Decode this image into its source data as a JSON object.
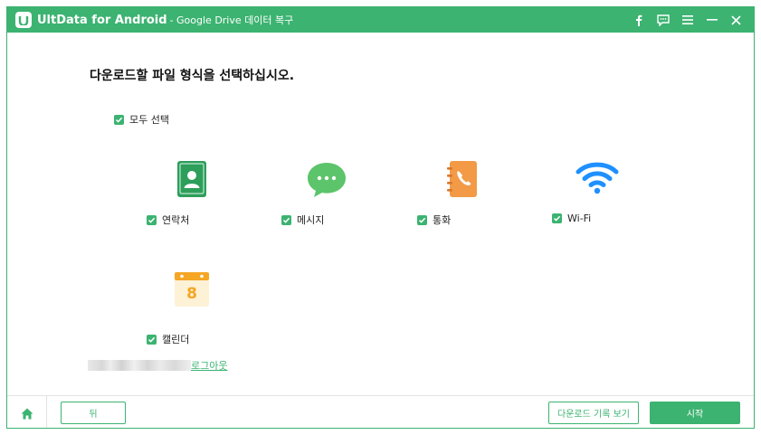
{
  "titlebar": {
    "app_name": "UltData for Android",
    "subtitle": "- Google Drive 데이터 복구",
    "icons": [
      "facebook-icon",
      "feedback-icon",
      "menu-icon",
      "minimize-icon",
      "close-icon"
    ]
  },
  "main": {
    "heading": "다운로드할 파일 형식을 선택하십시오.",
    "select_all": "모두 선택",
    "items": [
      {
        "label": "연락처",
        "icon": "contacts-icon",
        "checked": true
      },
      {
        "label": "메시지",
        "icon": "messages-icon",
        "checked": true
      },
      {
        "label": "통화",
        "icon": "call-log-icon",
        "checked": true
      },
      {
        "label": "Wi-Fi",
        "icon": "wifi-icon",
        "checked": true
      },
      {
        "label": "캘린더",
        "icon": "calendar-icon",
        "checked": true,
        "icon_text": "8"
      }
    ],
    "logout": "로그아웃"
  },
  "footer": {
    "back": "뒤",
    "history": "다운로드 기록 보기",
    "start": "시작"
  },
  "colors": {
    "accent": "#3cb371",
    "contacts": "#2e9e5b",
    "messages": "#5cc46a",
    "call": "#f29a46",
    "wifi": "#1e90ff",
    "calendar": "#f5a623"
  }
}
